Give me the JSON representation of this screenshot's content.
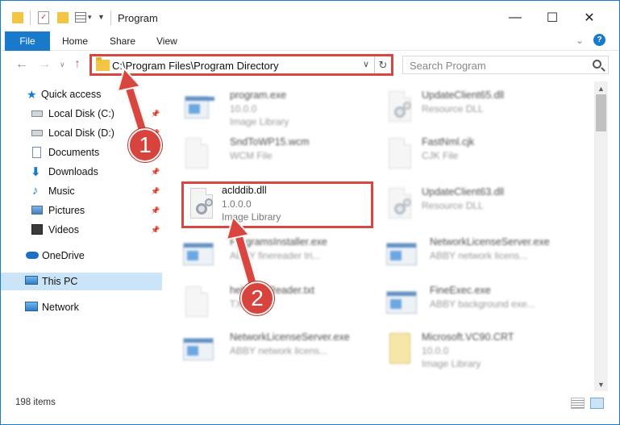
{
  "window": {
    "title": "Program",
    "controls": {
      "minimize": "—",
      "maximize": "☐",
      "close": "✕"
    }
  },
  "ribbon": {
    "tabs": [
      "File",
      "Home",
      "Share",
      "View"
    ],
    "help": "?"
  },
  "address_bar": {
    "path": "C:\\Program Files\\Program Directory"
  },
  "search": {
    "placeholder": "Search Program"
  },
  "sidebar": {
    "items": [
      {
        "label": "Quick access",
        "icon": "star-icon",
        "pinned": false
      },
      {
        "label": "Local Disk (C:)",
        "icon": "drive-icon",
        "pinned": true
      },
      {
        "label": "Local Disk (D:)",
        "icon": "drive-icon",
        "pinned": true
      },
      {
        "label": "Documents",
        "icon": "documents-icon",
        "pinned": true
      },
      {
        "label": "Downloads",
        "icon": "download-icon",
        "pinned": true
      },
      {
        "label": "Music",
        "icon": "music-icon",
        "pinned": true
      },
      {
        "label": "Pictures",
        "icon": "pictures-icon",
        "pinned": true
      },
      {
        "label": "Videos",
        "icon": "videos-icon",
        "pinned": true
      },
      {
        "label": "OneDrive",
        "icon": "cloud-icon",
        "pinned": false
      },
      {
        "label": "This PC",
        "icon": "computer-icon",
        "pinned": false,
        "selected": true
      },
      {
        "label": "Network",
        "icon": "network-icon",
        "pinned": false
      }
    ]
  },
  "files": [
    {
      "name": "program.exe",
      "line2": "10.0.0",
      "line3": "Image Library",
      "icon": "program-exe-icon",
      "blurred": true
    },
    {
      "name": "UpdateClient65.dll",
      "line2": "Resource DLL",
      "line3": "",
      "icon": "dll-icon",
      "blurred": true
    },
    {
      "name": "SndToWP15.wcm",
      "line2": "WCM File",
      "line3": "",
      "icon": "file-icon",
      "blurred": true
    },
    {
      "name": "FastNml.cjk",
      "line2": "CJK File",
      "line3": "",
      "icon": "file-icon",
      "blurred": true
    },
    {
      "name": "aclddib.dll",
      "line2": "1.0.0.0",
      "line3": "Image Library",
      "icon": "dll-icon",
      "blurred": false
    },
    {
      "name": "UpdateClient63.dll",
      "line2": "Resource DLL",
      "line3": "",
      "icon": "dll-icon",
      "blurred": true
    },
    {
      "name": "ProgramsInstaller.exe",
      "line2": "ABBY finereader tri...",
      "line3": "",
      "icon": "exe-icon",
      "blurred": true
    },
    {
      "name": "NetworkLicenseServer.exe",
      "line2": "ABBY network licens...",
      "line3": "",
      "icon": "exe-icon",
      "blurred": true
    },
    {
      "name": "helpFineReader.txt",
      "line2": "TXT File",
      "line3": "",
      "icon": "file-icon",
      "blurred": true
    },
    {
      "name": "FineExec.exe",
      "line2": "ABBY background exe...",
      "line3": "",
      "icon": "exe-icon",
      "blurred": true
    },
    {
      "name": "NetworkLicenseServer.exe",
      "line2": "ABBY network licens...",
      "line3": "",
      "icon": "exe-icon",
      "blurred": true
    },
    {
      "name": "Microsoft.VC90.CRT",
      "line2": "10.0.0",
      "line3": "Image Library",
      "icon": "crt-icon",
      "blurred": true
    }
  ],
  "status": {
    "count": "198 items"
  },
  "annotations": {
    "step1": "1",
    "step2": "2",
    "color": "#d9453f"
  }
}
